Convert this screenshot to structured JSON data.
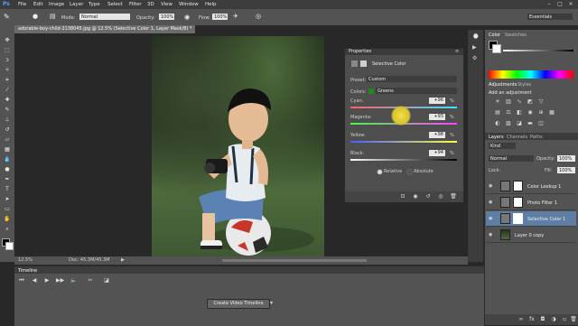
{
  "app": {
    "logo": "Ps"
  },
  "menu": [
    "File",
    "Edit",
    "Image",
    "Layer",
    "Type",
    "Select",
    "Filter",
    "3D",
    "View",
    "Window",
    "Help"
  ],
  "options": {
    "mode_label": "Mode:",
    "mode_value": "Normal",
    "opacity_label": "Opacity:",
    "opacity_value": "100%",
    "flow_label": "Flow:",
    "flow_value": "100%",
    "workspace": "Essentials"
  },
  "document": {
    "tab_title": "adorable-boy-child-2138045.jpg @ 12.5% (Selective Color 1, Layer Mask/8) *",
    "zoom": "12.5%",
    "doc_info": "Doc: 45.3M/45.3M"
  },
  "properties": {
    "panel_title": "Properties",
    "adjustment_name": "Selective Color",
    "preset_label": "Preset:",
    "preset_value": "Custom",
    "colors_label": "Colors:",
    "colors_value": "Greens",
    "sliders": [
      {
        "label": "Cyan:",
        "value": "+96",
        "unit": "%"
      },
      {
        "label": "Magenta:",
        "value": "+93",
        "unit": "%"
      },
      {
        "label": "Yellow:",
        "value": "+98",
        "unit": "%"
      },
      {
        "label": "Black:",
        "value": "+94",
        "unit": "%"
      }
    ],
    "method_relative": "Relative",
    "method_absolute": "Absolute"
  },
  "color_panel": {
    "tab_color": "Color",
    "tab_swatches": "Swatches"
  },
  "adjustments": {
    "tab": "Adjustments",
    "tab2": "Styles",
    "add_label": "Add an adjustment"
  },
  "layers_panel": {
    "tab_layers": "Layers",
    "tab_channels": "Channels",
    "tab_paths": "Paths",
    "filter_kind": "Kind",
    "blend_mode": "Normal",
    "opacity_label": "Opacity:",
    "opacity_value": "100%",
    "lock_label": "Lock:",
    "fill_label": "Fill:",
    "fill_value": "100%",
    "layers": [
      {
        "name": "Color Lookup 1",
        "selected": false
      },
      {
        "name": "Photo Filter 1",
        "selected": false
      },
      {
        "name": "Selective Color 1",
        "selected": true
      },
      {
        "name": "Layer 0 copy",
        "selected": false
      }
    ]
  },
  "timeline": {
    "tab": "Timeline",
    "create_button": "Create Video Timeline"
  },
  "colors": {
    "accent": "#4aa3ff",
    "greens_swatch": "#1f8a1f",
    "selected_layer": "#5f7ea3"
  }
}
